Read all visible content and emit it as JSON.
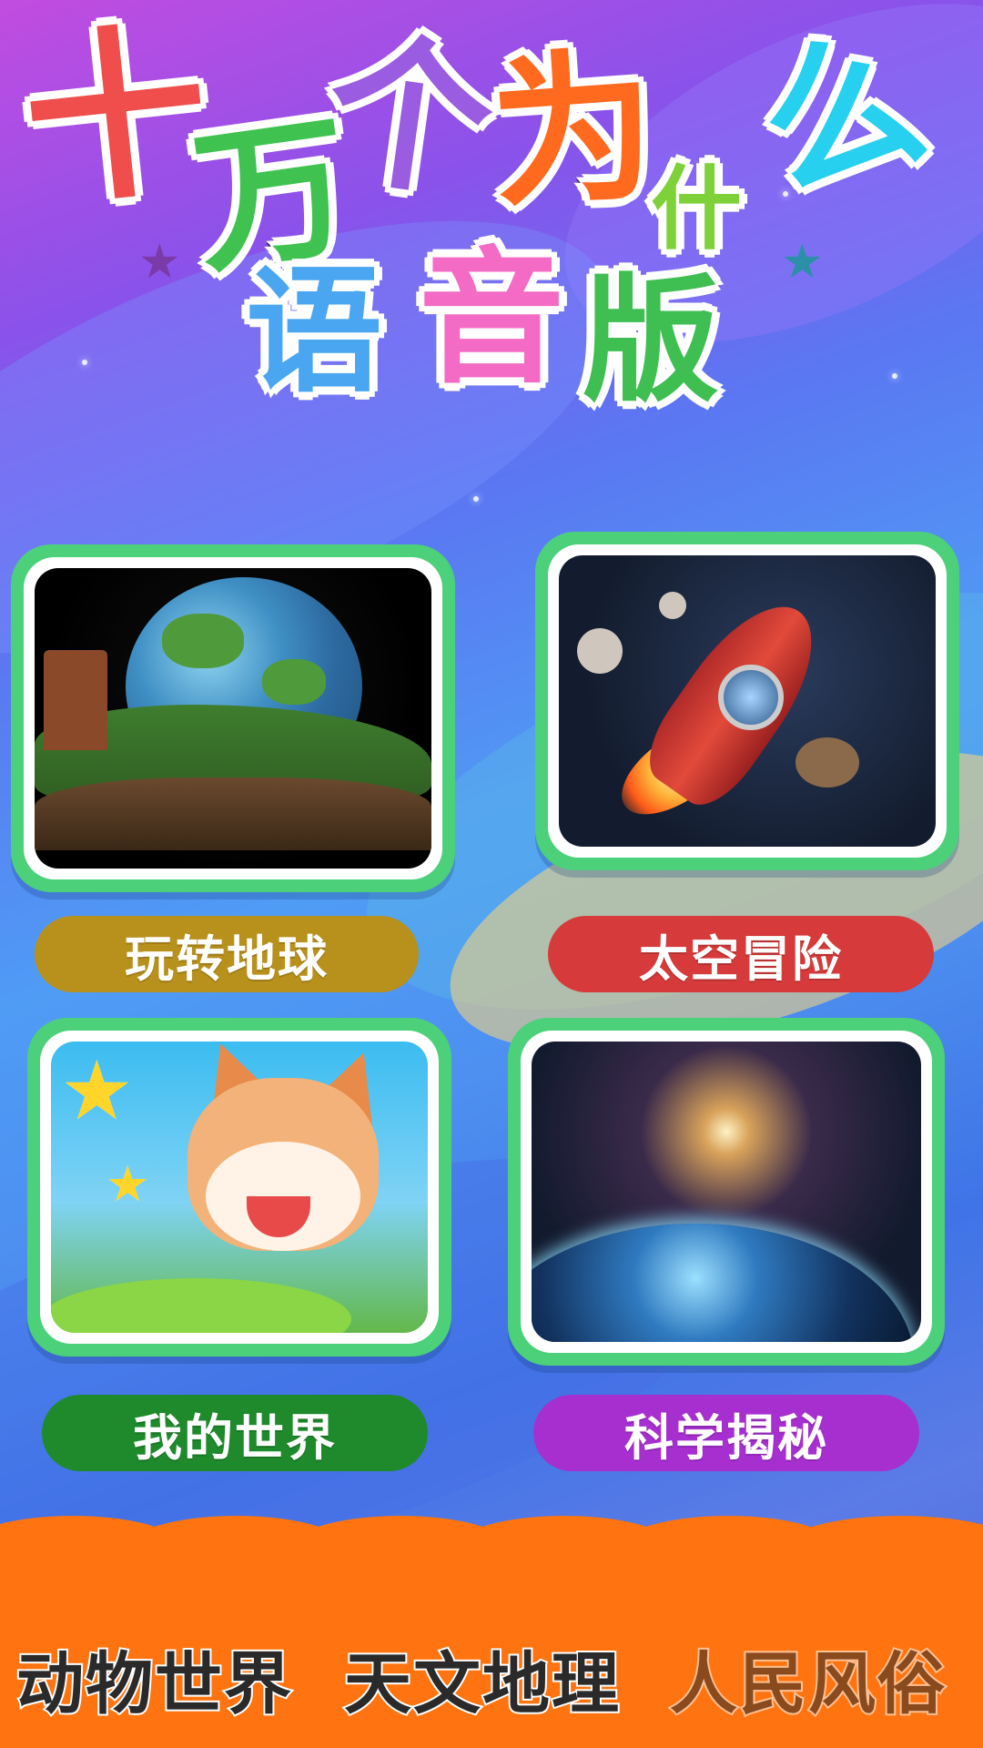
{
  "title": {
    "line1": [
      "十",
      "万",
      "个",
      "为",
      "什",
      "么"
    ],
    "line2": [
      "语",
      "音",
      "版"
    ],
    "colors": [
      "#f04d4d",
      "#3fc250",
      "#9a5ce0",
      "#ff6a1e",
      "#7fd13a",
      "#28d0f0",
      "#4aa6f0",
      "#f36bc4",
      "#3fbe52"
    ]
  },
  "categories": [
    {
      "label": "玩转地球",
      "color": "#b8901c"
    },
    {
      "label": "太空冒险",
      "color": "#d63a3a"
    },
    {
      "label": "我的世界",
      "color": "#1e8a2c"
    },
    {
      "label": "科学揭秘",
      "color": "#a72fd0"
    }
  ],
  "bottom": {
    "items": [
      "动物世界",
      "天文地理",
      "人民风俗"
    ],
    "color": "#ff7410"
  }
}
